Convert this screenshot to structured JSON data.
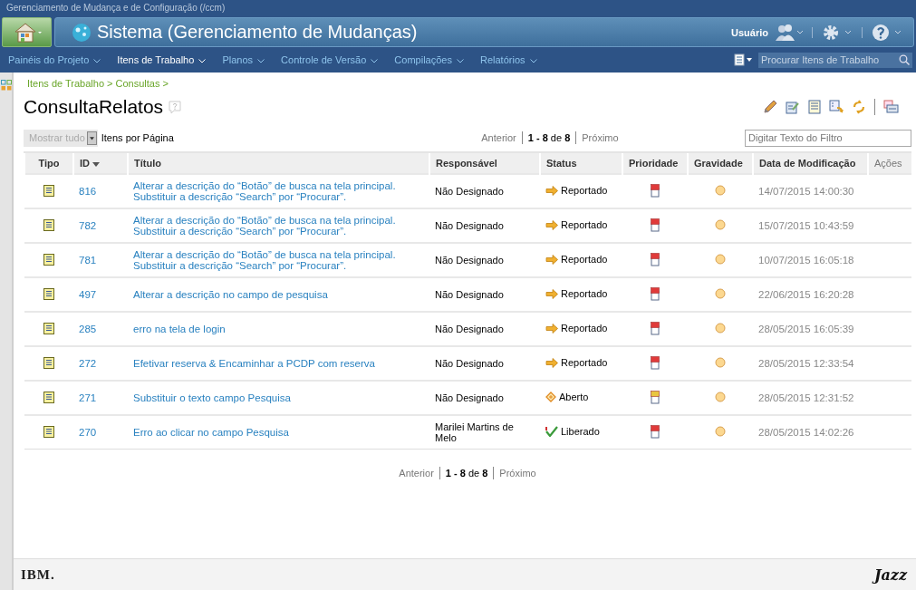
{
  "top_bar": {
    "title": "Gerenciamento de Mudança e de Configuração (/ccm)"
  },
  "banner": {
    "title": "Sistema (Gerenciamento de Mudanças)",
    "user": "Usuário"
  },
  "nav": [
    {
      "label": "Painéis do Projeto",
      "selected": false
    },
    {
      "label": "Itens de Trabalho",
      "selected": true
    },
    {
      "label": "Planos",
      "selected": false
    },
    {
      "label": "Controle de Versão",
      "selected": false
    },
    {
      "label": "Compilações",
      "selected": false
    },
    {
      "label": "Relatórios",
      "selected": false
    }
  ],
  "search": {
    "placeholder": "Procurar Itens de Trabalho"
  },
  "breadcrumb": "Itens de Trabalho > Consultas >",
  "page_title": "ConsultaRelatos",
  "page_size": {
    "value": "Mostrar tudo",
    "label": "Itens por Página"
  },
  "pager_top": {
    "previous": "Anterior",
    "range": "**1 - 8** de **8**",
    "next": "Próximo"
  },
  "filter": {
    "placeholder": "Digitar Texto do Filtro"
  },
  "table": {
    "columns": [
      {
        "label": "Tipo",
        "sorted": false
      },
      {
        "label": "ID",
        "sorted": true
      },
      {
        "label": "Título",
        "sorted": false
      },
      {
        "label": "Responsável",
        "sorted": false
      },
      {
        "label": "Status",
        "sorted": false
      },
      {
        "label": "Prioridade",
        "sorted": false
      },
      {
        "label": "Gravidade",
        "sorted": false
      },
      {
        "label": "Data de Modificação",
        "sorted": false
      },
      {
        "label": "Ações",
        "sorted": false
      }
    ],
    "rows": [
      {
        "id": "816",
        "title": "Alterar a descrição do “Botão” de busca na tela principal. Substituir a descrição “Search” por “Procurar”.",
        "owner": "Não Designado",
        "status": {
          "label": "Reportado",
          "kind": "reported"
        },
        "priority": {
          "kind": "high"
        },
        "modified": "14/07/2015 14:00:30"
      },
      {
        "id": "782",
        "title": "Alterar a descrição do “Botão” de busca na tela principal. Substituir a descrição “Search” por “Procurar”.",
        "owner": "Não Designado",
        "status": {
          "label": "Reportado",
          "kind": "reported"
        },
        "priority": {
          "kind": "high"
        },
        "modified": "15/07/2015 10:43:59"
      },
      {
        "id": "781",
        "title": "Alterar a descrição do “Botão” de busca na tela principal. Substituir a descrição “Search” por “Procurar”.",
        "owner": "Não Designado",
        "status": {
          "label": "Reportado",
          "kind": "reported"
        },
        "priority": {
          "kind": "high"
        },
        "modified": "10/07/2015 16:05:18"
      },
      {
        "id": "497",
        "title": "Alterar a descrição no campo de pesquisa",
        "owner": "Não Designado",
        "status": {
          "label": "Reportado",
          "kind": "reported"
        },
        "priority": {
          "kind": "high"
        },
        "modified": "22/06/2015 16:20:28"
      },
      {
        "id": "285",
        "title": "erro na tela de login",
        "owner": "Não Designado",
        "status": {
          "label": "Reportado",
          "kind": "reported"
        },
        "priority": {
          "kind": "high"
        },
        "modified": "28/05/2015 16:05:39"
      },
      {
        "id": "272",
        "title": "Efetivar reserva & Encaminhar a PCDP com reserva",
        "owner": "Não Designado",
        "status": {
          "label": "Reportado",
          "kind": "reported"
        },
        "priority": {
          "kind": "high"
        },
        "modified": "28/05/2015 12:33:54"
      },
      {
        "id": "271",
        "title": "Substituir o texto campo Pesquisa",
        "owner": "Não Designado",
        "status": {
          "label": "Aberto",
          "kind": "open"
        },
        "priority": {
          "kind": "medium"
        },
        "modified": "28/05/2015 12:31:52"
      },
      {
        "id": "270",
        "title": "Erro ao clicar no campo Pesquisa",
        "owner": "Marilei Martins de Melo",
        "status": {
          "label": "Liberado",
          "kind": "released"
        },
        "priority": {
          "kind": "high"
        },
        "modified": "28/05/2015 14:02:26"
      }
    ]
  },
  "pager_bottom": {
    "previous": "Anterior",
    "range": "**1 - 8** de **8**",
    "next": "Próximo"
  },
  "footer": {
    "left_logo": "IBM.",
    "right_logo": "Jazz"
  }
}
